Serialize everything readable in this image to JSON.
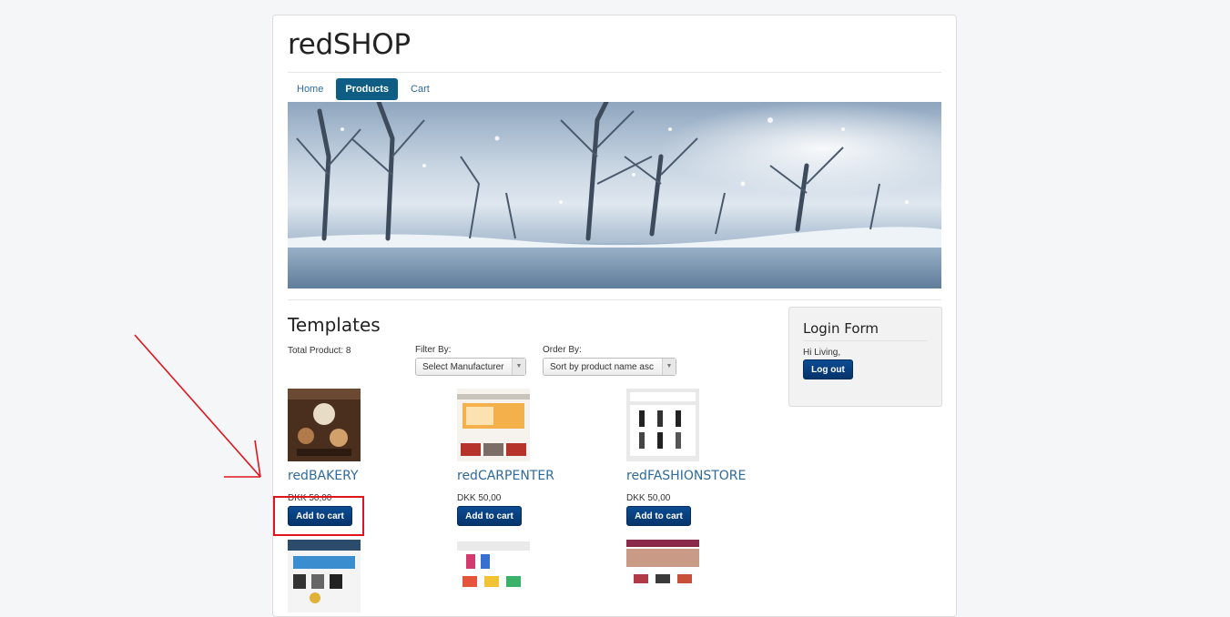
{
  "site": {
    "brand": "redSHOP"
  },
  "nav": {
    "items": [
      {
        "label": "Home",
        "active": false
      },
      {
        "label": "Products",
        "active": true
      },
      {
        "label": "Cart",
        "active": false
      }
    ]
  },
  "category": {
    "title": "Templates",
    "total_label": "Total Product: 8",
    "filter_label": "Filter By:",
    "filter_value": "Select Manufacturer",
    "order_label": "Order By:",
    "order_value": "Sort by product name asc"
  },
  "products": [
    {
      "name": "redBAKERY",
      "price": "DKK 50,00",
      "button": "Add to cart"
    },
    {
      "name": "redCARPENTER",
      "price": "DKK 50,00",
      "button": "Add to cart"
    },
    {
      "name": "redFASHIONSTORE",
      "price": "DKK 50,00",
      "button": "Add to cart"
    }
  ],
  "login": {
    "title": "Login Form",
    "greeting": "Hi Living,",
    "logout_label": "Log out"
  },
  "colors": {
    "accent": "#0e5d85",
    "button": "#0a4486",
    "link": "#2f6a9c",
    "annotation": "#e0141e"
  }
}
